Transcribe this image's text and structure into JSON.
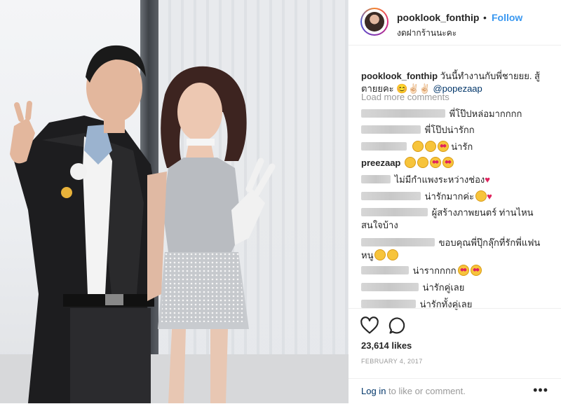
{
  "post": {
    "username": "pooklook_fonthip",
    "separator": "•",
    "follow_label": "Follow",
    "location": "งดฝากร้านนะคะ"
  },
  "caption": {
    "username": "pooklook_fonthip",
    "text": "วันนี้ทำงานกับพี่ชายยย. สู้ตายยคะ 😊✌🏻✌🏻",
    "mention": "@popezaap"
  },
  "comments": {
    "load_more": "Load more comments",
    "items": [
      {
        "text": "พี่โป๊ปหล่อมากกกก"
      },
      {
        "text": "พี่โป๊ปน่ารักก"
      },
      {
        "text": "น่ารัก"
      },
      {
        "user": "preezaap",
        "text": ""
      },
      {
        "text": "ไม่มีกำแพงระหว่างช่อง"
      },
      {
        "text": "น่ารักมากค่ะ"
      },
      {
        "text": "ผู้สร้างภาพยนตร์ ท่านไหนสนใจบ้าง"
      },
      {
        "text": "ขอบคุณพี่ปุ๊กลุ๊กที่รักพี่แฟนหนู"
      },
      {
        "text": "น่ารากกกก"
      },
      {
        "text": "น่ารักคู่เลย"
      },
      {
        "text": "น่ารักทั้งคู่เลย"
      }
    ]
  },
  "stats": {
    "likes": "23,614 likes",
    "date": "FEBRUARY 4, 2017"
  },
  "footer": {
    "login_link": "Log in",
    "login_suffix": " to like or comment.",
    "more": "•••"
  },
  "icons": {
    "like": "heart-outline-icon",
    "comment": "speech-bubble-icon",
    "more": "ellipsis-icon"
  },
  "colors": {
    "follow": "#3897f0",
    "mention": "#003569",
    "muted": "#999999"
  }
}
